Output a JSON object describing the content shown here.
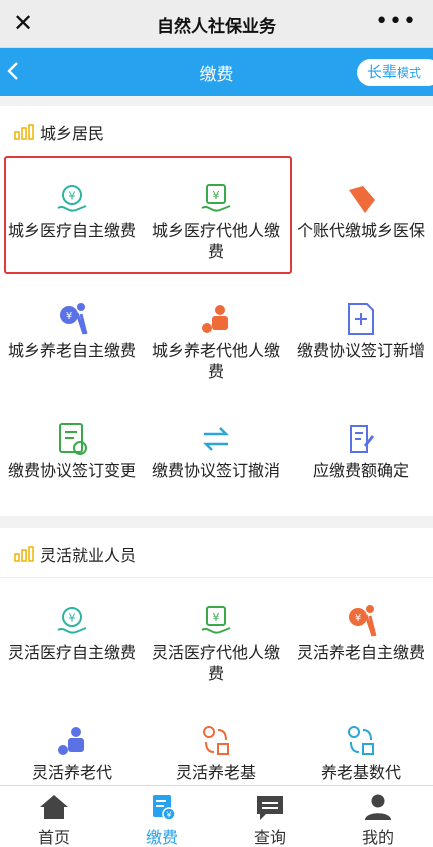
{
  "window": {
    "close_glyph": "✕",
    "title": "自然人社保业务",
    "more_glyph": "•••"
  },
  "nav": {
    "title": "缴费",
    "elder_mode_main": "长辈",
    "elder_mode_small": "模式"
  },
  "section_urban_rural": {
    "title": "城乡居民",
    "items": [
      {
        "label": "城乡医疗自主缴费",
        "icon": "medical-self-pay-icon",
        "color": "#2bb5a0"
      },
      {
        "label": "城乡医疗代他人缴费",
        "icon": "medical-proxy-pay-icon",
        "color": "#3aa94a"
      },
      {
        "label": "个账代缴城乡医保",
        "icon": "personal-account-pay-icon",
        "color": "#ef6b3a"
      },
      {
        "label": "城乡养老自主缴费",
        "icon": "pension-self-pay-icon",
        "color": "#5b72e6"
      },
      {
        "label": "城乡养老代他人缴费",
        "icon": "pension-proxy-pay-icon",
        "color": "#ef6b3a"
      },
      {
        "label": "缴费协议签订新增",
        "icon": "agreement-add-icon",
        "color": "#5b72e6"
      },
      {
        "label": "缴费协议签订变更",
        "icon": "agreement-change-icon",
        "color": "#3aa94a"
      },
      {
        "label": "缴费协议签订撤消",
        "icon": "agreement-cancel-icon",
        "color": "#2aa6d8"
      },
      {
        "label": "应缴费额确定",
        "icon": "amount-confirm-icon",
        "color": "#5b72e6"
      }
    ]
  },
  "section_flexible": {
    "title": "灵活就业人员",
    "items": [
      {
        "label": "灵活医疗自主缴费",
        "icon": "flex-medical-self-icon",
        "color": "#2bb5a0"
      },
      {
        "label": "灵活医疗代他人缴费",
        "icon": "flex-medical-proxy-icon",
        "color": "#3aa94a"
      },
      {
        "label": "灵活养老自主缴费",
        "icon": "flex-pension-self-icon",
        "color": "#ef6b3a"
      },
      {
        "label": "灵活养老代",
        "icon": "flex-pension-proxy-icon",
        "color": "#5b72e6"
      },
      {
        "label": "灵活养老基",
        "icon": "flex-pension-base-icon",
        "color": "#ef6b3a"
      },
      {
        "label": "养老基数代",
        "icon": "pension-base-proxy-icon",
        "color": "#2aa6d8"
      }
    ]
  },
  "tabbar": {
    "tabs": [
      {
        "label": "首页",
        "icon": "home-icon"
      },
      {
        "label": "缴费",
        "icon": "payment-icon"
      },
      {
        "label": "查询",
        "icon": "query-icon"
      },
      {
        "label": "我的",
        "icon": "profile-icon"
      }
    ]
  },
  "colors": {
    "accent": "#27a2ef",
    "highlight_border": "#e03a3a",
    "section_bar": "#f0b400"
  }
}
